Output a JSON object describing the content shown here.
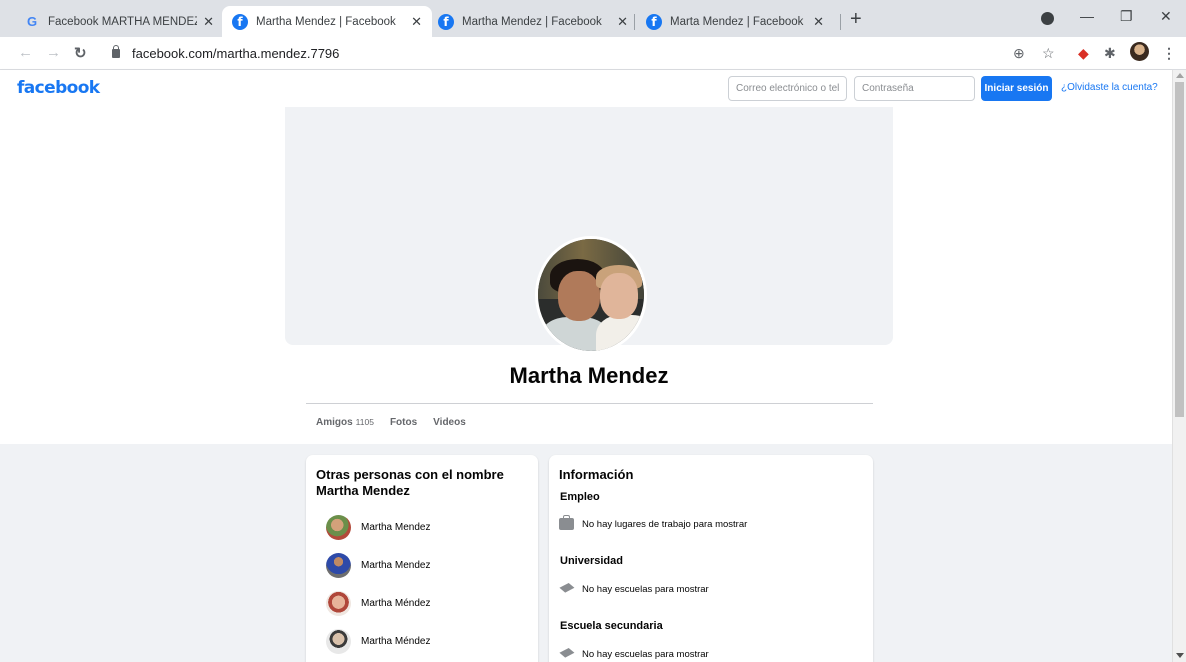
{
  "browser": {
    "tabs": [
      {
        "title": "Facebook MARTHA MENDEZ SO",
        "favicon": "google-icon",
        "active": false
      },
      {
        "title": "Martha Mendez | Facebook",
        "favicon": "facebook-icon",
        "active": true
      },
      {
        "title": "Martha Mendez | Facebook",
        "favicon": "facebook-icon",
        "active": false
      },
      {
        "title": "Marta Mendez | Facebook",
        "favicon": "facebook-icon",
        "active": false
      }
    ],
    "url": "facebook.com/martha.mendez.7796"
  },
  "header": {
    "logo": "facebook",
    "email_placeholder": "Correo electrónico o teléfono",
    "password_placeholder": "Contraseña",
    "login_label": "Iniciar sesión",
    "forgot_label": "¿Olvidaste la cuenta?",
    "brand_color": "#1877f2"
  },
  "profile": {
    "name": "Martha Mendez",
    "tabs": [
      {
        "label": "Amigos",
        "count": "1105"
      },
      {
        "label": "Fotos",
        "count": ""
      },
      {
        "label": "Videos",
        "count": ""
      }
    ]
  },
  "others": {
    "title": "Otras personas con el nombre Martha Mendez",
    "people": [
      {
        "name": "Martha Mendez"
      },
      {
        "name": "Martha Mendez"
      },
      {
        "name": "Martha Méndez"
      },
      {
        "name": "Martha Méndez"
      }
    ]
  },
  "info": {
    "title": "Información",
    "sections": [
      {
        "label": "Empleo",
        "text": "No hay lugares de trabajo para mostrar",
        "icon": "briefcase-icon"
      },
      {
        "label": "Universidad",
        "text": "No hay escuelas para mostrar",
        "icon": "graduation-cap-icon"
      },
      {
        "label": "Escuela secundaria",
        "text": "No hay escuelas para mostrar",
        "icon": "graduation-cap-icon"
      }
    ]
  }
}
